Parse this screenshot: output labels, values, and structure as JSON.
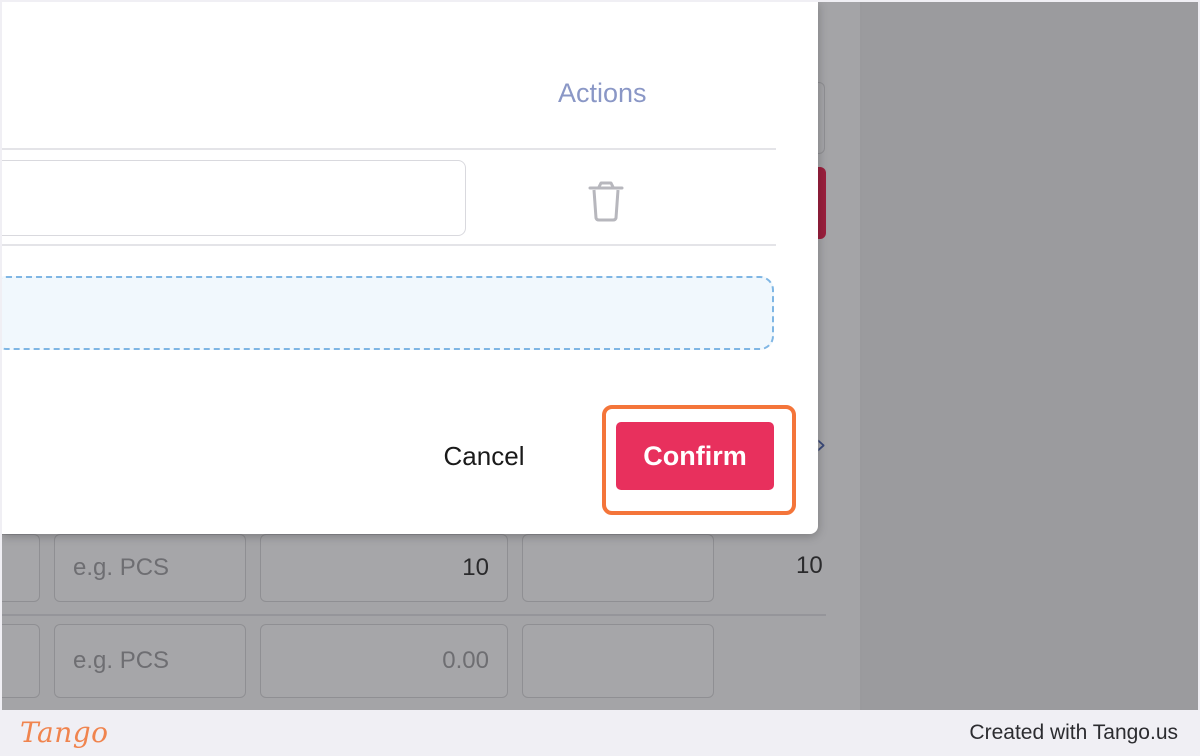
{
  "background_table": {
    "rows": [
      {
        "unit_placeholder": "e.g. PCS",
        "quantity": "10",
        "total": "10"
      },
      {
        "unit_placeholder": "e.g. PCS",
        "quantity": "0.00",
        "total": ""
      }
    ]
  },
  "modal": {
    "columns": {
      "actions_header": "Actions"
    },
    "delete_icon": "trash-icon",
    "cancel_label": "Cancel",
    "confirm_label": "Confirm"
  },
  "colors": {
    "confirm_button": "#e8305d",
    "highlight": "#f4753a",
    "actions_header": "#8a97c6",
    "dropzone_border": "#7fb6e4",
    "tango_brand": "#f0844e"
  },
  "footer": {
    "logo": "Tango",
    "credit": "Created with Tango.us"
  }
}
